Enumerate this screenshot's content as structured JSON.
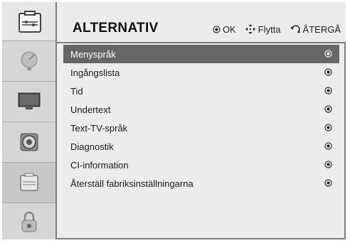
{
  "header": {
    "title": "ALTERNATIV",
    "hints": [
      {
        "icon": "ok-dot-icon",
        "label": "OK"
      },
      {
        "icon": "move-arrows-icon",
        "label": "Flytta"
      },
      {
        "icon": "back-arrow-icon",
        "label": "ÅTERGÅ"
      }
    ]
  },
  "sidebar": {
    "items": [
      {
        "name": "satellite-dish-icon",
        "selected": false
      },
      {
        "name": "tv-monitor-icon",
        "selected": false
      },
      {
        "name": "speaker-icon",
        "selected": false
      },
      {
        "name": "options-icon",
        "selected": true
      },
      {
        "name": "lock-icon",
        "selected": false
      }
    ]
  },
  "menu": {
    "items": [
      {
        "label": "Menyspråk",
        "selected": true
      },
      {
        "label": "Ingångslista",
        "selected": false
      },
      {
        "label": "Tid",
        "selected": false
      },
      {
        "label": "Undertext",
        "selected": false
      },
      {
        "label": "Text-TV-språk",
        "selected": false
      },
      {
        "label": "Diagnostik",
        "selected": false
      },
      {
        "label": "CI-information",
        "selected": false
      },
      {
        "label": "Återställ fabriksinställningarna",
        "selected": false
      }
    ]
  },
  "colors": {
    "selected_row": "#666666",
    "panel_bg": "#ececec",
    "border": "#7d7d7d"
  }
}
